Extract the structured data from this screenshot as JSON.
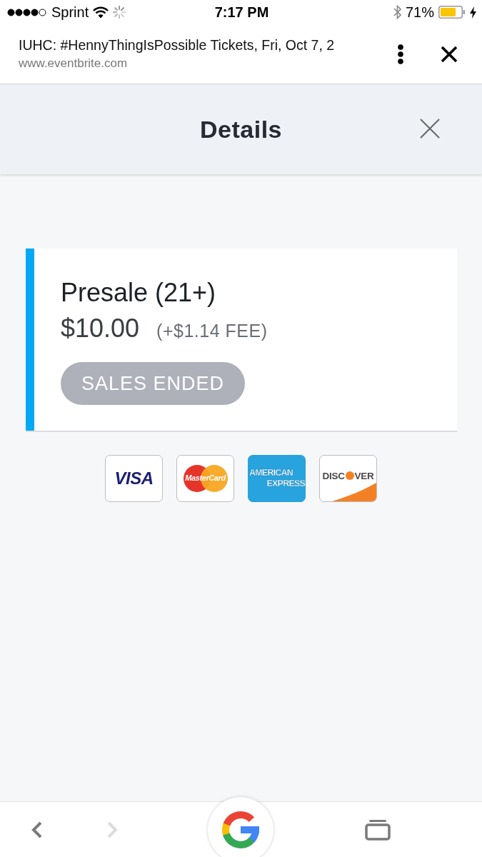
{
  "status_bar": {
    "carrier": "Sprint",
    "time": "7:17 PM",
    "battery": "71%"
  },
  "browser_bar": {
    "title": "IUHC: #HennyThingIsPossible Tickets, Fri, Oct 7, 2",
    "url": "www.eventbrite.com"
  },
  "modal": {
    "title": "Details"
  },
  "ticket": {
    "name": "Presale (21+)",
    "price": "$10.00",
    "fee": "(+$1.14 FEE)",
    "button": {
      "label": "SALES ENDED",
      "disabled": true
    }
  },
  "payment_methods": [
    {
      "kind": "visa",
      "parts": [
        "VISA"
      ]
    },
    {
      "kind": "mastercard",
      "parts": [
        "MasterCard"
      ]
    },
    {
      "kind": "amex",
      "parts": [
        "AMERICAN",
        "EXPRESS"
      ]
    },
    {
      "kind": "discover",
      "parts": [
        "DISC",
        "VER"
      ]
    }
  ],
  "nav_buttons": [
    {
      "kind": "back",
      "disabled": false
    },
    {
      "kind": "forward",
      "disabled": true
    }
  ]
}
